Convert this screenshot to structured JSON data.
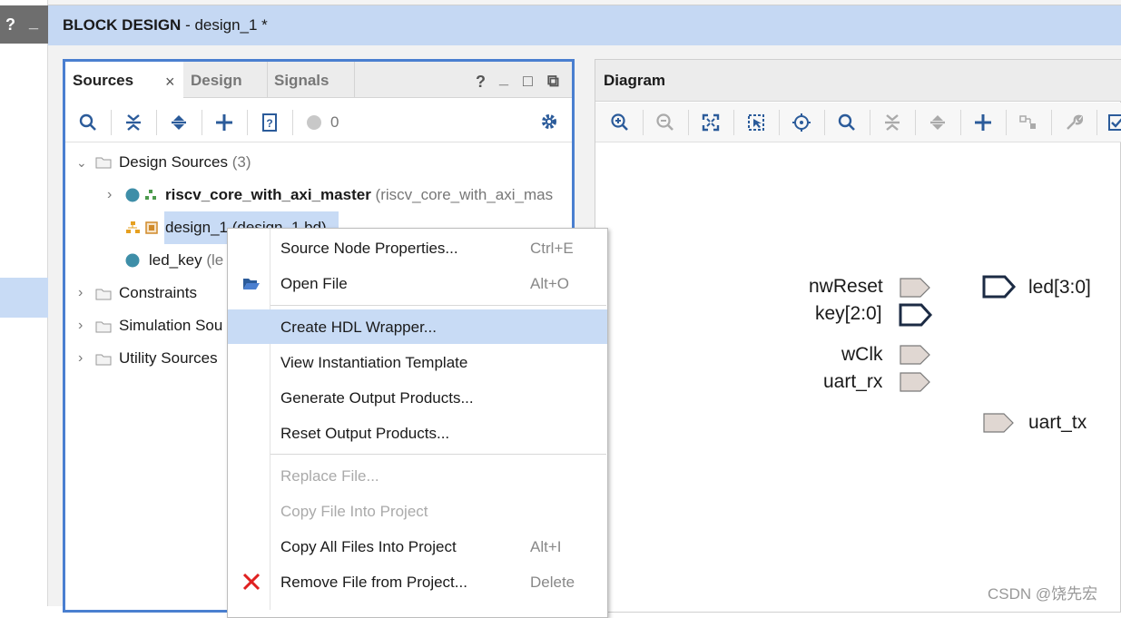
{
  "header": {
    "title_bold": "BLOCK DESIGN",
    "title_rest": " - design_1 *"
  },
  "left_strip": {
    "help_label": "?",
    "minimize_label": "_"
  },
  "sources_panel": {
    "tabs": [
      {
        "label": "Sources",
        "close": "×"
      },
      {
        "label": "Design"
      },
      {
        "label": "Signals"
      }
    ],
    "window_buttons": {
      "help": "?",
      "minimize": "_",
      "maximize": "□",
      "float": "⧉"
    },
    "toolbar": {
      "status_count": "0"
    },
    "tree": {
      "design_sources": {
        "label": "Design Sources",
        "count": "(3)"
      },
      "riscv": {
        "name": "riscv_core_with_axi_master",
        "detail": "(riscv_core_with_axi_mas"
      },
      "design1": {
        "name": "design_1",
        "detail": "(design_1.bd)"
      },
      "ledkey": {
        "name": "led_key",
        "detail": "(le"
      },
      "constraints": {
        "label": "Constraints"
      },
      "simulation": {
        "label": "Simulation Sou"
      },
      "utility": {
        "label": "Utility Sources"
      }
    }
  },
  "diagram": {
    "title": "Diagram",
    "ports": {
      "nwReset": "nwReset",
      "key": "key[2:0]",
      "wClk": "wClk",
      "uart_rx": "uart_rx",
      "led": "led[3:0]",
      "uart_tx": "uart_tx"
    }
  },
  "context_menu": {
    "items": [
      {
        "label": "Source Node Properties...",
        "shortcut": "Ctrl+E"
      },
      {
        "label": "Open File",
        "shortcut": "Alt+O"
      },
      {
        "label": "Create HDL Wrapper...",
        "shortcut": ""
      },
      {
        "label": "View Instantiation Template",
        "shortcut": ""
      },
      {
        "label": "Generate Output Products...",
        "shortcut": ""
      },
      {
        "label": "Reset Output Products...",
        "shortcut": ""
      },
      {
        "label": "Replace File...",
        "shortcut": ""
      },
      {
        "label": "Copy File Into Project",
        "shortcut": ""
      },
      {
        "label": "Copy All Files Into Project",
        "shortcut": "Alt+I"
      },
      {
        "label": "Remove File from Project...",
        "shortcut": "Delete"
      }
    ]
  },
  "watermark": "CSDN @饶先宏",
  "colors": {
    "accent_border": "#4a7fd0",
    "selection": "#c8dbf5",
    "header_band": "#c5d8f3",
    "icon_blue": "#2b5b9a",
    "remove_red": "#e02020",
    "port_fill": "#e0d7d2"
  }
}
